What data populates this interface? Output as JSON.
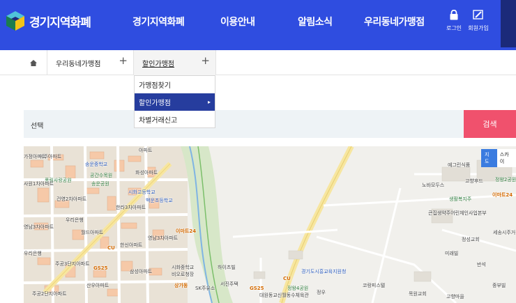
{
  "header": {
    "logo_text": "경기지역화폐",
    "nav": [
      "경기지역화폐",
      "이용안내",
      "알림소식",
      "우리동네가맹점"
    ],
    "login_label": "로그인",
    "join_label": "회원가입"
  },
  "breadcrumb": {
    "home_icon": "home-icon",
    "items": [
      "우리동네가맹점",
      "할인가맹점"
    ]
  },
  "dropdown": {
    "items": [
      "가맹점찾기",
      "할인가맹점",
      "차별거래신고"
    ],
    "selected": "할인가맹점"
  },
  "search": {
    "label": "선택",
    "button_label": "검색"
  },
  "map": {
    "type_map": "지도",
    "type_sky": "스카이",
    "labels": [
      "미주아파트",
      "가정아파트",
      "아파트",
      "송운중학교",
      "공간수목원",
      "풍림사랑공원",
      "송운공원",
      "화성아파트",
      "건영2차아파트",
      "한라3차아파트",
      "사원1차아파트",
      "시화고등학교",
      "백운초등학교",
      "영남3차아파트",
      "우리은행",
      "월드아파트",
      "한신아파트",
      "영남3차아파트",
      "이마트24",
      "주공3단지아파트",
      "시화중학교",
      "비오로청장",
      "삼성아파트",
      "GS25",
      "CU",
      "우리은행",
      "산우아파트",
      "주공2단지아파트",
      "상가동",
      "SK주유소",
      "서진주택",
      "하이츠빌",
      "경기도시흥교육지원청",
      "GS25",
      "정왕4공원",
      "CU",
      "대원동교신월동수체육관",
      "정우",
      "코랑피스텔",
      "목원교회",
      "노바모두스",
      "고향후드",
      "예그린식품",
      "정왕2공원",
      "생활복지주",
      "큰집생약주어린체인사업본부",
      "이마트24",
      "정성교회",
      "고향마을",
      "세송시주거관",
      "미래빌",
      "반석",
      "중부빌"
    ]
  }
}
